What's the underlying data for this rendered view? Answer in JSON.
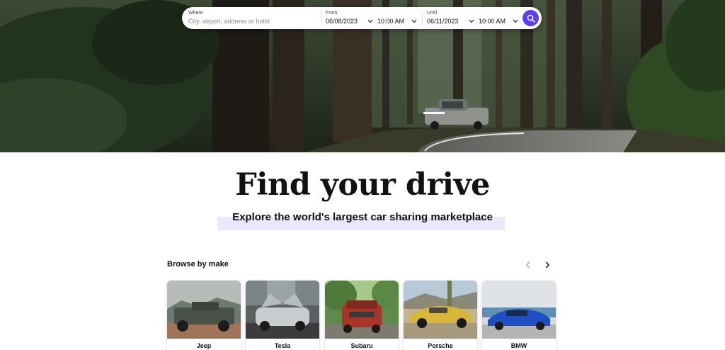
{
  "search": {
    "where_label": "Where",
    "where_placeholder": "City, airport, address or hotel",
    "from_label": "From",
    "from_date": "06/08/2023",
    "from_time": "10:00 AM",
    "until_label": "Until",
    "until_date": "06/11/2023",
    "until_time": "10:00 AM",
    "button_icon": "search-icon",
    "accent_color": "#5b3df5"
  },
  "hero": {
    "headline": "Find your drive",
    "subheadline": "Explore the world's largest car sharing marketplace",
    "highlight_color": "#ece8fb"
  },
  "browse": {
    "title": "Browse by make",
    "prev_icon": "chevron-left-icon",
    "next_icon": "chevron-right-icon",
    "makes": [
      {
        "label": "Jeep"
      },
      {
        "label": "Tesla"
      },
      {
        "label": "Subaru"
      },
      {
        "label": "Porsche"
      },
      {
        "label": "BMW"
      }
    ]
  }
}
